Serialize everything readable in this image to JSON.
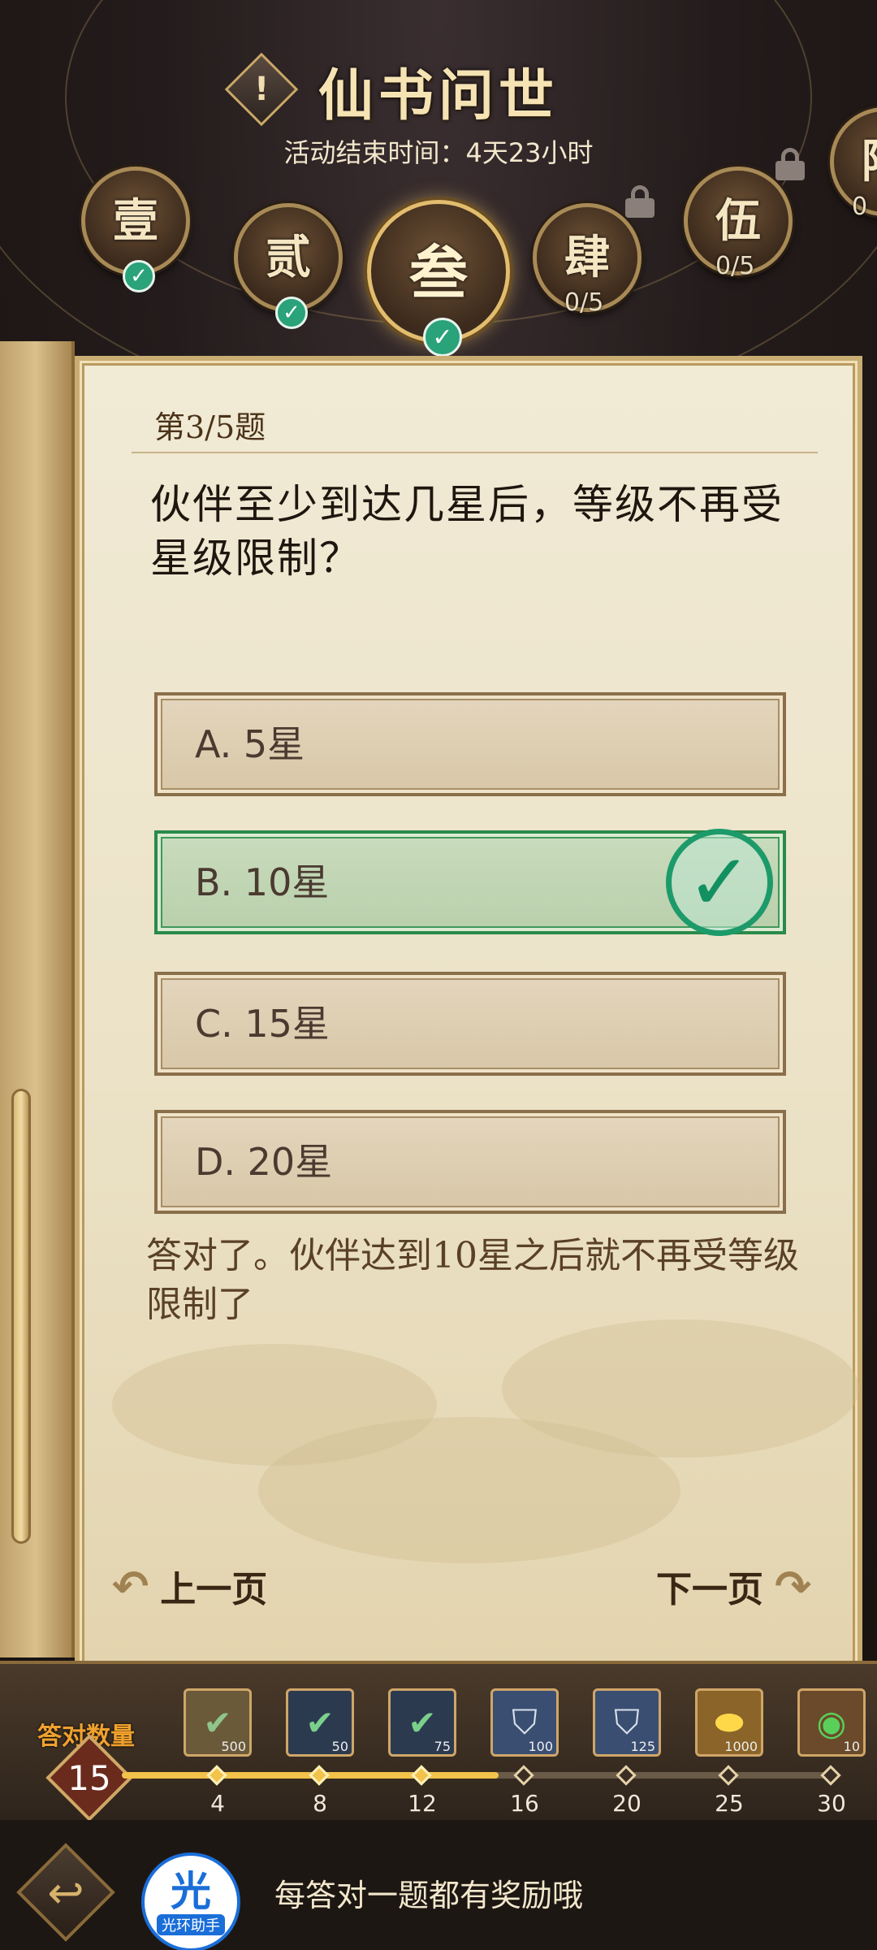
{
  "header": {
    "title": "仙书问世",
    "end_time": "活动结束时间：4天23小时",
    "chapters": [
      {
        "label": "壹",
        "state": "completed"
      },
      {
        "label": "贰",
        "state": "completed"
      },
      {
        "label": "叁",
        "state": "completed",
        "active": true
      },
      {
        "label": "肆",
        "state": "locked",
        "progress": "0/5"
      },
      {
        "label": "伍",
        "state": "locked",
        "progress": "0/5"
      },
      {
        "label": "陆",
        "state": "locked",
        "progress": "0"
      }
    ]
  },
  "quiz": {
    "question_number": "第3/5题",
    "question": "伙伴至少到达几星后，等级不再受星级限制？",
    "options": [
      {
        "label": "A. 5星",
        "correct": false
      },
      {
        "label": "B. 10星",
        "correct": true
      },
      {
        "label": "C. 15星",
        "correct": false
      },
      {
        "label": "D. 20星",
        "correct": false
      }
    ],
    "explanation": "答对了。伙伴达到10星之后就不再受等级限制了",
    "prev_label": "上一页",
    "next_label": "下一页"
  },
  "rewards": {
    "label": "答对数量",
    "count": "15",
    "progress_value": 15,
    "progress_max": 30,
    "milestones": [
      "4",
      "8",
      "12",
      "16",
      "20",
      "25",
      "30"
    ],
    "items": [
      {
        "icon": "jade-scroll-icon",
        "qty": "500",
        "claimed": true
      },
      {
        "icon": "spirit-stone-icon",
        "qty": "50",
        "claimed": true
      },
      {
        "icon": "spirit-stone-icon",
        "qty": "75",
        "claimed": true
      },
      {
        "icon": "bucket-icon",
        "qty": "100",
        "claimed": false
      },
      {
        "icon": "bucket-icon",
        "qty": "125",
        "claimed": false
      },
      {
        "icon": "gold-ingot-icon",
        "qty": "1000",
        "claimed": false
      },
      {
        "icon": "jade-dragon-icon",
        "qty": "10",
        "claimed": false
      }
    ]
  },
  "footer": {
    "helper_big": "光",
    "helper_small": "光环助手",
    "hint": "每答对一题都有奖励哦"
  },
  "colors": {
    "accent": "#c9ad73",
    "correct": "#1d9a6a",
    "progress": "#f3c24a"
  }
}
